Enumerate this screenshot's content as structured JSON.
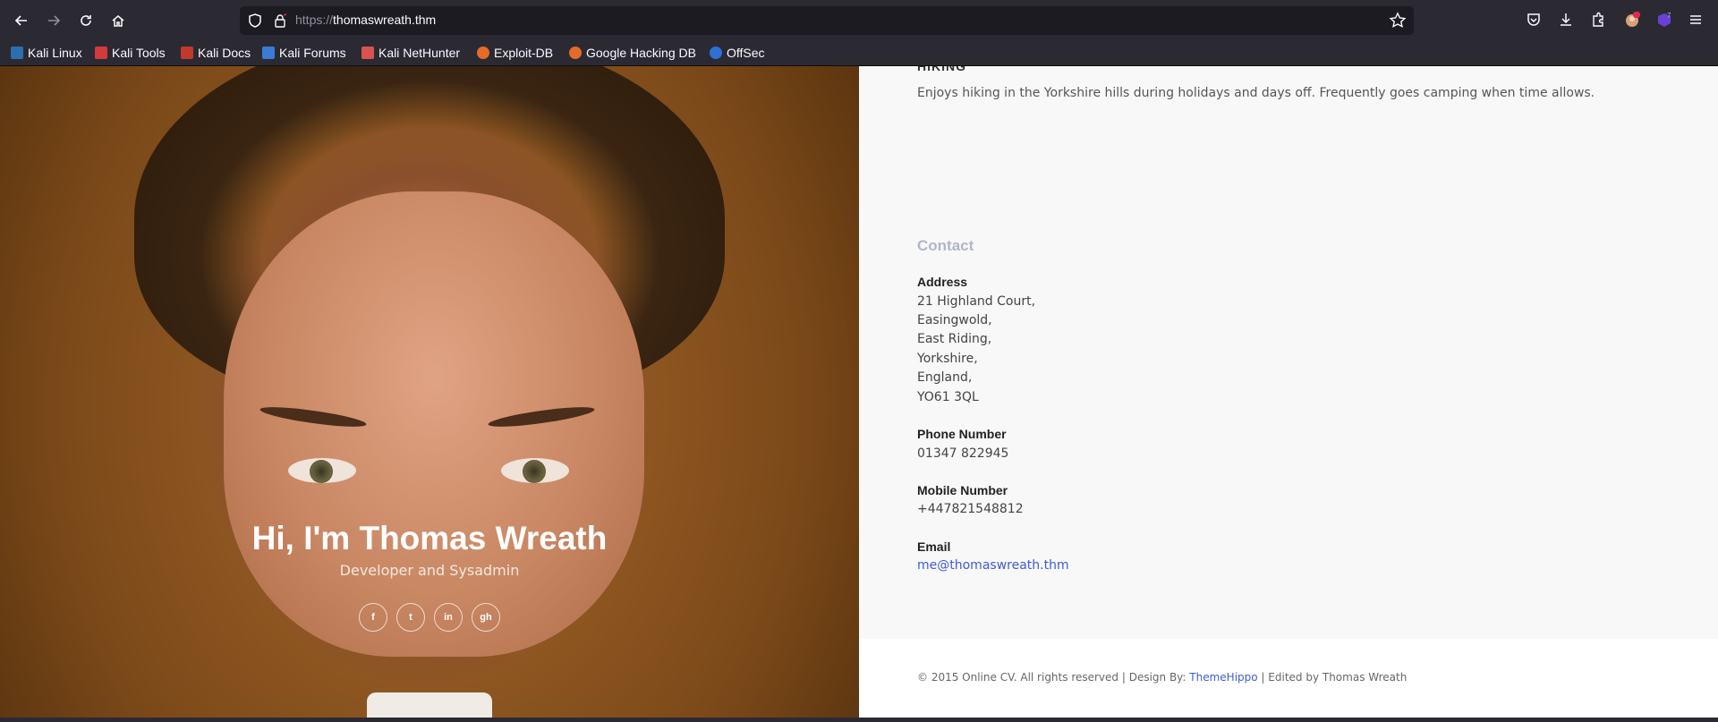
{
  "browser": {
    "url_prefix": "https://",
    "url_host": "thomaswreath.thm",
    "extension_badge": "7",
    "icons": [
      "back-icon",
      "forward-icon",
      "reload-icon",
      "home-icon",
      "shield-icon",
      "lock-icon",
      "star-icon",
      "pocket-icon",
      "download-icon",
      "extensions-icon",
      "profile-icon",
      "extension-icon",
      "menu-icon"
    ]
  },
  "bookmarks": [
    {
      "label": "Kali Linux",
      "color": "#2a6fb0"
    },
    {
      "label": "Kali Tools",
      "color": "#d13b3b"
    },
    {
      "label": "Kali Docs",
      "color": "#c0392b"
    },
    {
      "label": "Kali Forums",
      "color": "#3a7bd5"
    },
    {
      "label": "Kali NetHunter",
      "color": "#d9534f"
    },
    {
      "label": "Exploit-DB",
      "color": "#e46b2a"
    },
    {
      "label": "Google Hacking DB",
      "color": "#e46b2a"
    },
    {
      "label": "OffSec",
      "color": "#2f6fd6"
    }
  ],
  "hero": {
    "title": "Hi, I'm Thomas Wreath",
    "subtitle": "Developer and Sysadmin",
    "socials": [
      {
        "label": "f",
        "icon": "facebook-icon"
      },
      {
        "label": "t",
        "icon": "twitter-icon"
      },
      {
        "label": "in",
        "icon": "linkedin-icon"
      },
      {
        "label": "gh",
        "icon": "github-icon"
      }
    ]
  },
  "hobbies": {
    "heading": "HIKING",
    "text": "Enjoys hiking in the Yorkshire hills during holidays and days off. Frequently goes camping when time allows."
  },
  "contact": {
    "title": "Contact",
    "address_label": "Address",
    "address_lines": [
      "21 Highland Court,",
      "Easingwold,",
      "East Riding,",
      "Yorkshire,",
      "England,",
      "YO61 3QL"
    ],
    "phone_label": "Phone Number",
    "phone": "01347 822945",
    "mobile_label": "Mobile Number",
    "mobile": "+447821548812",
    "email_label": "Email",
    "email": "me@thomaswreath.thm"
  },
  "footer": {
    "prefix": "© 2015 Online CV. All rights reserved | Design By: ",
    "designer": "ThemeHippo",
    "suffix": " | Edited by Thomas Wreath"
  },
  "colors": {
    "accent_link": "#3f5bd6",
    "contact_title": "#b0b7c6",
    "browser_toolbar": "#2b2a33"
  }
}
